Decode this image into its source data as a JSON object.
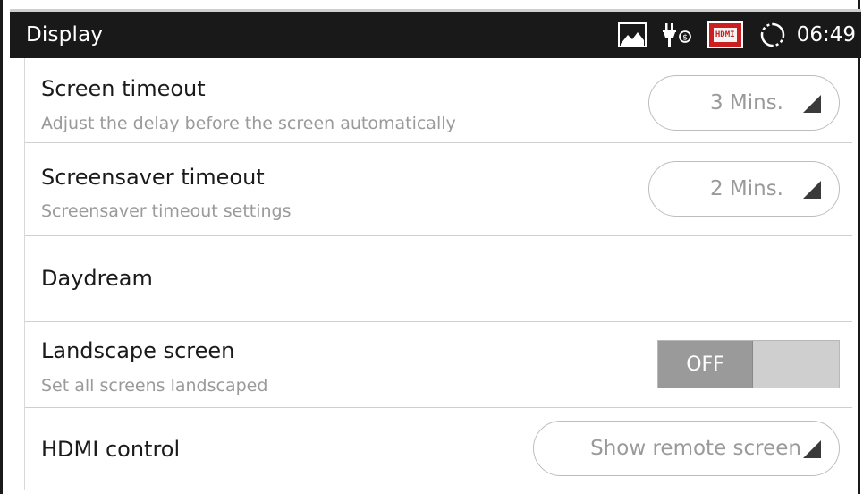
{
  "statusbar": {
    "title": "Display",
    "icons": [
      "gallery-icon",
      "usb-debug-icon",
      "hdmi-icon",
      "sync-icon"
    ],
    "hdmi_badge": "HDMI",
    "time": "06:49"
  },
  "settings": [
    {
      "title": "Screen timeout",
      "subtitle": "Adjust the delay before the screen automatically",
      "control": "spinner",
      "value": "3 Mins."
    },
    {
      "title": "Screensaver timeout",
      "subtitle": "Screensaver timeout settings",
      "control": "spinner",
      "value": "2 Mins."
    },
    {
      "title": "Daydream"
    },
    {
      "title": "Landscape screen",
      "subtitle": "Set all screens landscaped",
      "control": "toggle",
      "value": "OFF"
    },
    {
      "title": "HDMI control",
      "control": "spinner",
      "value": "Show remote screen"
    }
  ],
  "colors": {
    "statusbar_bg": "#191919",
    "hdmi_badge": "#cc1e1e",
    "toggle_off": "#9a9a9a",
    "subtitle_text": "#9a9a9a"
  }
}
